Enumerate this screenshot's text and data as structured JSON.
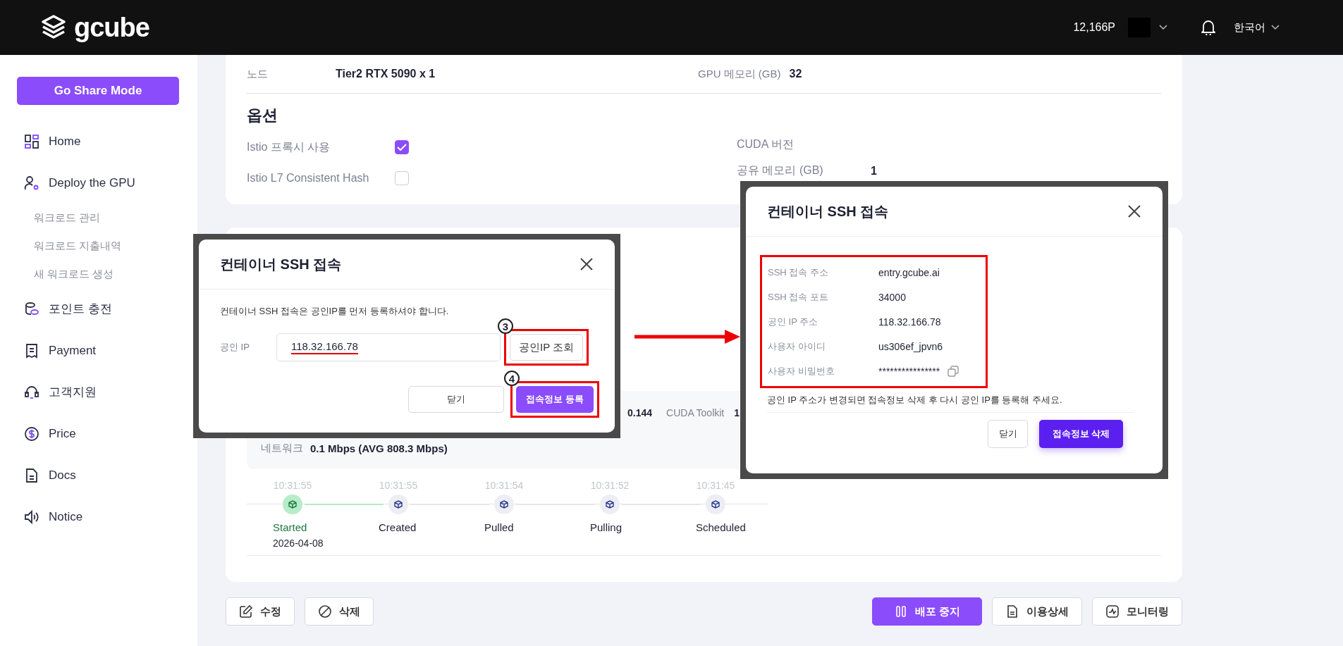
{
  "header": {
    "brand": "gcube",
    "points": "12,166P",
    "language": "한국어"
  },
  "sidebar": {
    "share_button": "Go Share Mode",
    "items": [
      {
        "label": "Home"
      },
      {
        "label": "Deploy the GPU",
        "children": [
          {
            "label": "워크로드 관리"
          },
          {
            "label": "워크로드 지출내역"
          },
          {
            "label": "새 워크로드 생성"
          }
        ]
      },
      {
        "label": "포인트 충전"
      },
      {
        "label": "Payment"
      },
      {
        "label": "고객지원"
      },
      {
        "label": "Price"
      },
      {
        "label": "Docs"
      },
      {
        "label": "Notice"
      }
    ]
  },
  "node_row": [
    {
      "label": "노드",
      "value": "Tier2 RTX 5090 x 1"
    },
    {
      "label": "GPU 메모리 (GB)",
      "value": "32"
    }
  ],
  "options": {
    "title": "옵션",
    "checks": [
      {
        "label": "Istio 프록시 사용",
        "checked": true
      },
      {
        "label": "Istio L7 Consistent Hash",
        "checked": false
      }
    ],
    "fields": [
      {
        "label": "CUDA 버전"
      },
      {
        "label": "공유 메모리 (GB)",
        "value": "1"
      }
    ]
  },
  "spec_row": [
    {
      "value": "0.144"
    },
    {
      "label": "CUDA Toolkit",
      "value": "1"
    }
  ],
  "network": {
    "label": "네트워크",
    "value": "0.1 Mbps (AVG 808.3 Mbps)"
  },
  "timeline": [
    {
      "time": "10:31:55",
      "label": "Started",
      "date": "2026-04-08",
      "done": true
    },
    {
      "time": "10:31:55",
      "label": "Created",
      "done": false
    },
    {
      "time": "10:31:54",
      "label": "Pulled",
      "done": false
    },
    {
      "time": "10:31:52",
      "label": "Pulling",
      "done": false
    },
    {
      "time": "10:31:45",
      "label": "Scheduled",
      "done": false
    }
  ],
  "actions_left": [
    {
      "label": "수정"
    },
    {
      "label": "삭제"
    }
  ],
  "actions_right": [
    {
      "label": "배포 중지",
      "primary": true
    },
    {
      "label": "이용상세",
      "primary": false
    },
    {
      "label": "모니터링",
      "primary": false
    }
  ],
  "register_dialog": {
    "title": "컨테이너 SSH 접속",
    "message": "컨테이너 SSH 접속은 공인IP를 먼저 등록하셔야 합니다.",
    "ip_label": "공인 IP",
    "ip_value": "118.32.166.78",
    "lookup_button": "공인IP 조회",
    "lookup_step": "3",
    "close_button": "닫기",
    "register_button": "접속정보 등록",
    "register_step": "4"
  },
  "info_dialog": {
    "title": "컨테이너 SSH 접속",
    "rows": [
      {
        "label": "SSH 접속 주소",
        "value": "entry.gcube.ai"
      },
      {
        "label": "SSH 접속 포트",
        "value": "34000"
      },
      {
        "label": "공인 IP 주소",
        "value": "118.32.166.78"
      },
      {
        "label": "사용자 아이디",
        "value": "us306ef_jpvn6"
      },
      {
        "label": "사용자 비밀번호",
        "value": "****************",
        "copyable": true
      }
    ],
    "note": "공인 IP 주소가 변경되면 접속정보 삭제 후 다시 공인 IP를 등록해 주세요.",
    "close_button": "닫기",
    "delete_button": "접속정보 삭제"
  }
}
